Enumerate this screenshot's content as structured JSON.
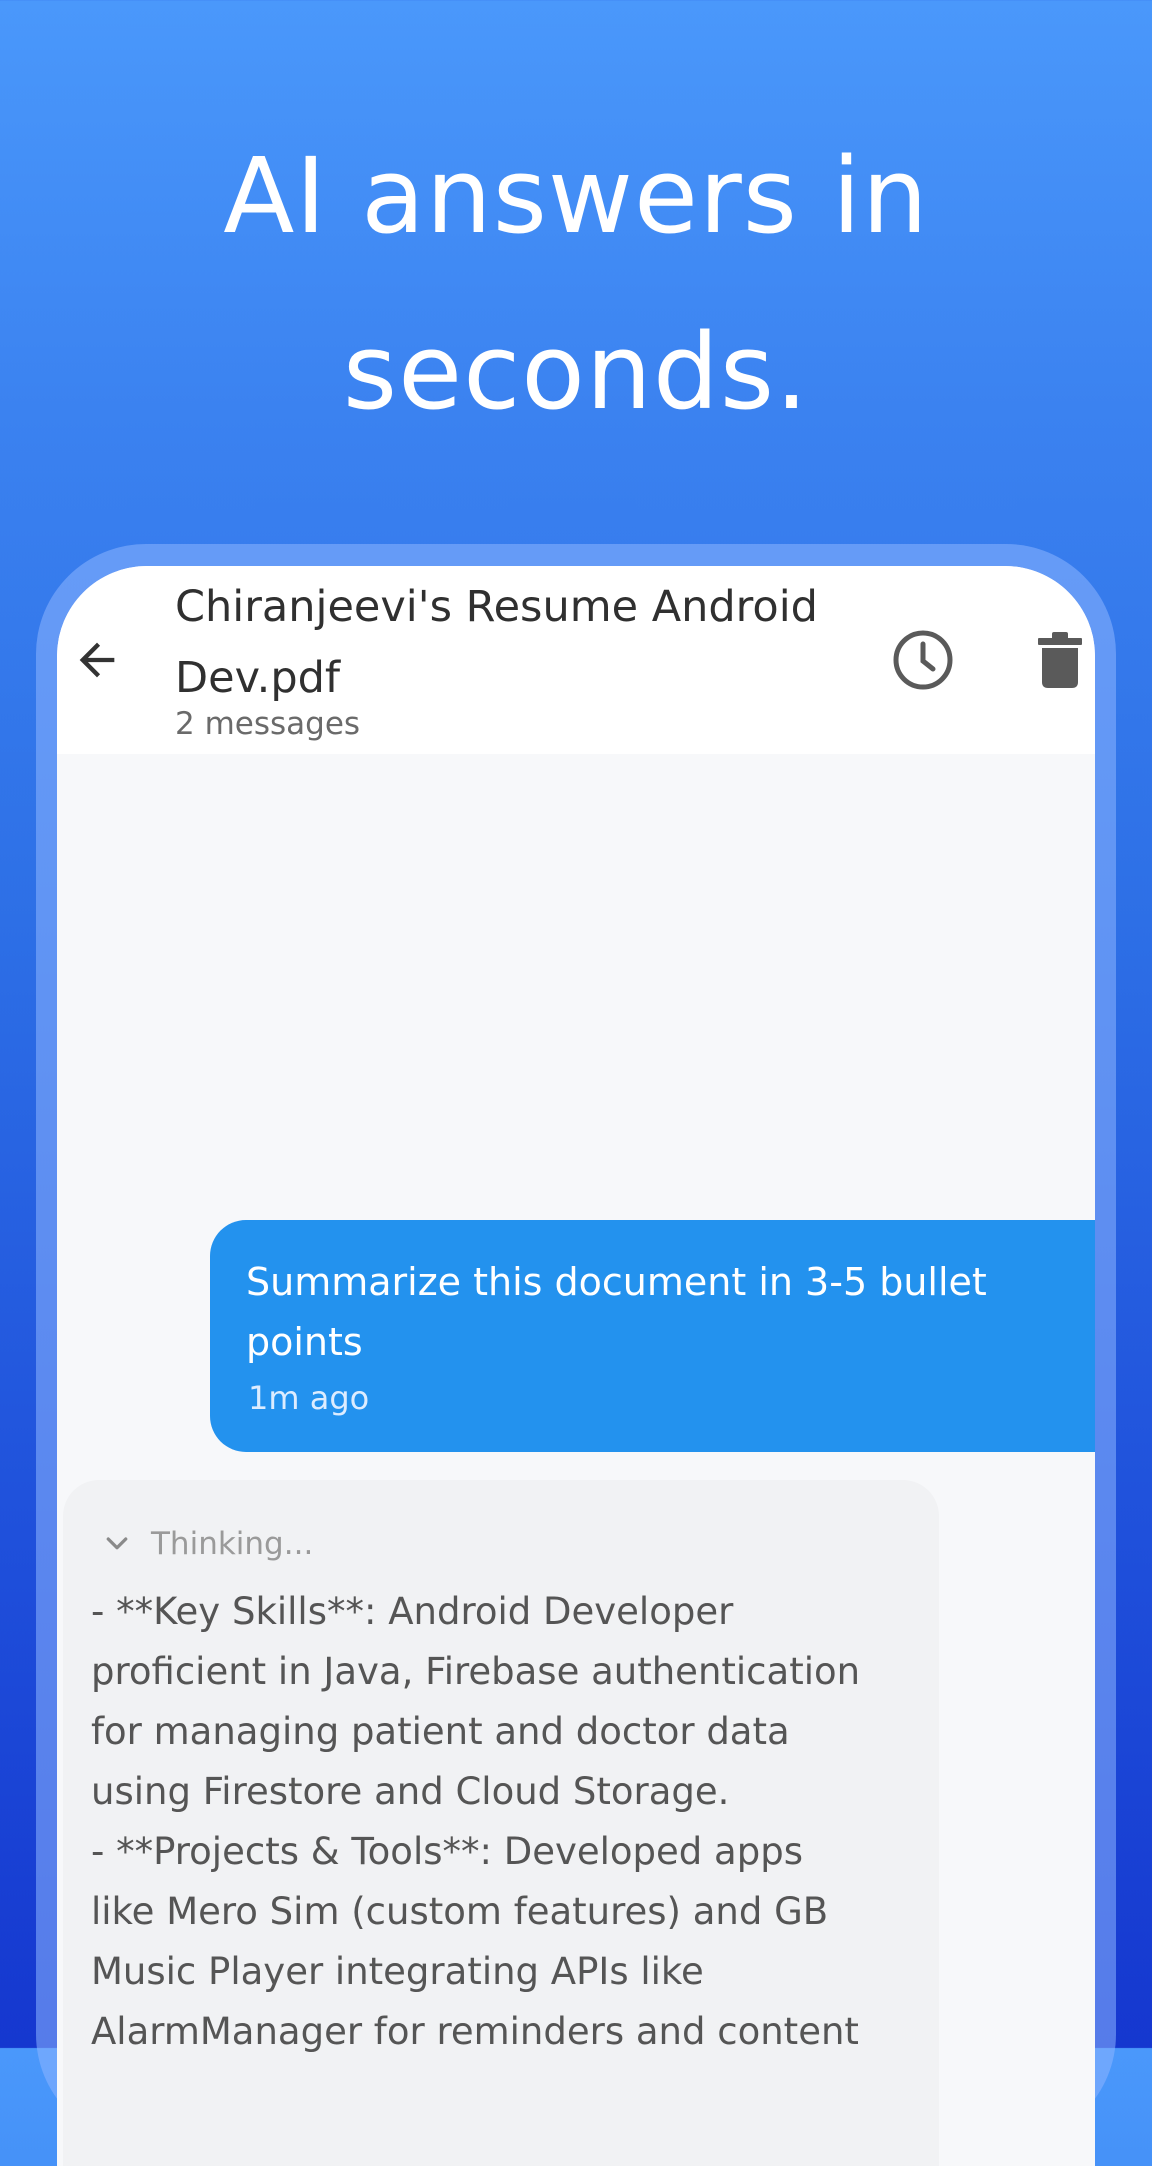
{
  "headline": {
    "line1": "AI answers in",
    "line2": "seconds."
  },
  "app_bar": {
    "title_line1": "Chiranjeevi's Resume Android",
    "title_line2": "Dev.pdf",
    "subtitle": "2 messages",
    "icons": [
      "back-arrow-icon",
      "history-icon",
      "trash-icon"
    ]
  },
  "chat": {
    "user_message": {
      "text_line1": "Summarize this document in 3-5 bullet",
      "text_line2": "points",
      "time": "1m ago"
    },
    "ai_message": {
      "thinking_label": "Thinking...",
      "text": "- **Key Skills**: Android Developer\nproficient in Java, Firebase authentication\nfor managing patient and doctor data\nusing Firestore and Cloud Storage.\n- **Projects & Tools**: Developed apps\nlike Mero Sim (custom features) and GB\nMusic Player integrating APIs like\nAlarmManager for reminders and content"
    }
  },
  "colors": {
    "background_top": "#4a98fb",
    "background_bottom": "#1537cf",
    "user_bubble": "#2392ee",
    "ai_bubble": "#f1f2f4"
  }
}
